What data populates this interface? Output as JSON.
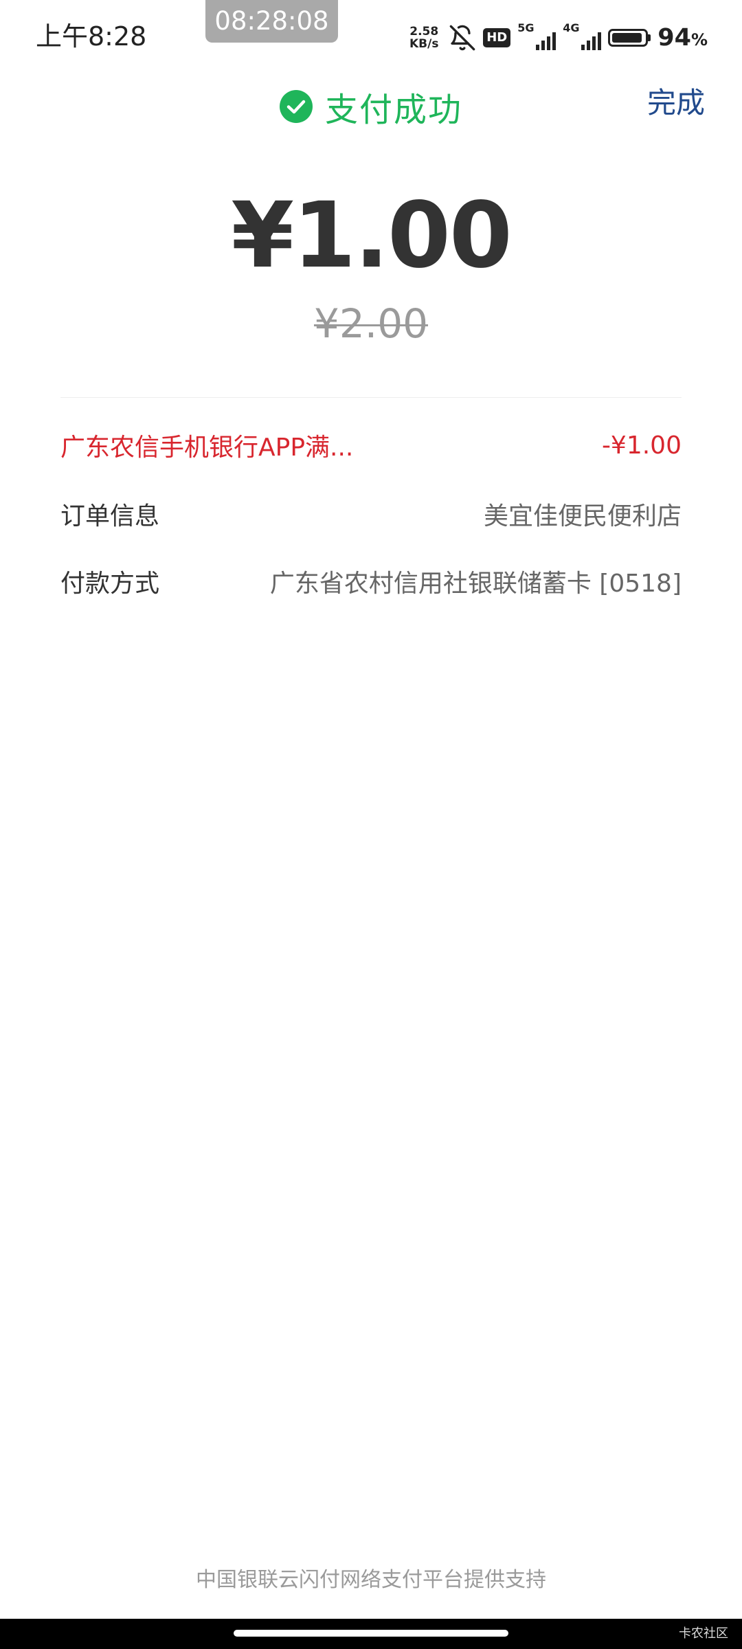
{
  "status_bar": {
    "time": "上午8:28",
    "timer": "08:28:08",
    "net_speed_value": "2.58",
    "net_speed_unit": "KB/s",
    "hd_label": "HD",
    "signal1_tag": "5G",
    "signal2_tag": "4G",
    "battery_percent": "94",
    "battery_unit": "%",
    "battery_level": 0.94
  },
  "header": {
    "title": "支付成功",
    "done_label": "完成",
    "title_color": "#1fb55a",
    "done_color": "#214a8c"
  },
  "payment": {
    "amount": "¥1.00",
    "original_amount": "¥2.00"
  },
  "details": {
    "discount": {
      "label": "广东农信手机银行APP满...",
      "value": "-¥1.00",
      "color": "#d8262e"
    },
    "order": {
      "label": "订单信息",
      "value": "美宜佳便民便利店"
    },
    "payment_method": {
      "label": "付款方式",
      "value": "广东省农村信用社银联储蓄卡 [0518]"
    }
  },
  "footer": {
    "text": "中国银联云闪付网络支付平台提供支持",
    "watermark": "卡农社区"
  },
  "icons": {
    "success": "check-circle-icon",
    "mute": "bell-off-icon",
    "battery": "battery-icon"
  }
}
